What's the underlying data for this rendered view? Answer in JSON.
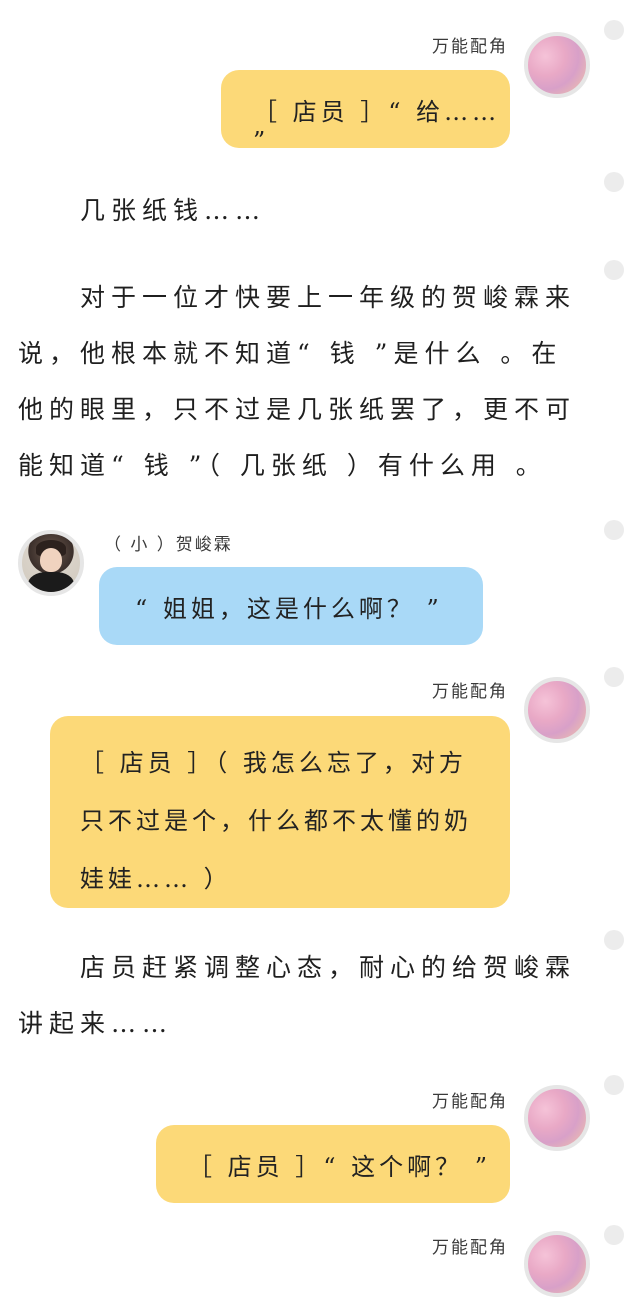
{
  "messages": {
    "m1": {
      "speaker": "万能配角",
      "text": "［ 店员 ］“ 给…… ”"
    },
    "n1": {
      "text": "几张纸钱……"
    },
    "n2": {
      "text": "对于一位才快要上一年级的贺峻霖来说，他根本就不知道“ 钱 ”是什么 。在他的眼里，只不过是几张纸罢了，更不可能知道“ 钱 ”（ 几张纸 ）有什么用 。"
    },
    "m2": {
      "speaker": "（ 小 ）贺峻霖",
      "text": "“ 姐姐，这是什么啊？ ”"
    },
    "m3": {
      "speaker": "万能配角",
      "text": "［ 店员 ］（ 我怎么忘了，对方只不过是个，什么都不太懂的奶娃娃…… ）"
    },
    "n3": {
      "text": "店员赶紧调整心态，耐心的给贺峻霖讲起来……"
    },
    "m4": {
      "speaker": "万能配角",
      "text": "［ 店员 ］“ 这个啊？ ”"
    },
    "m5": {
      "speaker": "万能配角"
    }
  },
  "avatars": {
    "pink": "pink-sky-avatar",
    "boy": "child-portrait-avatar"
  },
  "colors": {
    "yellow_bubble": "#fcd978",
    "blue_bubble": "#a9d9f7",
    "dot": "#ececec"
  }
}
